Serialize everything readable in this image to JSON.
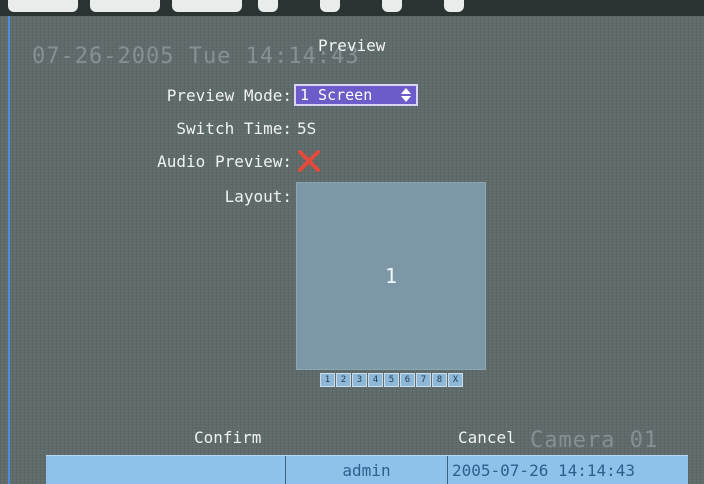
{
  "osd": {
    "datetime": "07-26-2005 Tue 14:14:43",
    "camera": "Camera 01"
  },
  "dialog": {
    "title": "Preview",
    "preview_mode": {
      "label": "Preview Mode:",
      "value": "1 Screen"
    },
    "switch_time": {
      "label": "Switch Time:",
      "value": "5S"
    },
    "audio_preview": {
      "label": "Audio Preview:",
      "enabled": false,
      "icon": "x-mark-icon"
    },
    "layout": {
      "label": "Layout:",
      "cells": [
        "1"
      ],
      "channel_buttons": [
        "1",
        "2",
        "3",
        "4",
        "5",
        "6",
        "7",
        "8",
        "X"
      ]
    },
    "buttons": {
      "confirm": "Confirm",
      "cancel": "Cancel"
    }
  },
  "status_bar": {
    "cells": [
      "",
      "admin",
      "2005-07-26 14:14:43"
    ]
  },
  "colors": {
    "background": "#5f6a6a",
    "selection": "#6c5cc9",
    "status_bar": "#8fc2ea",
    "x_mark": "#e5493a",
    "layout_box": "#7c97a5"
  }
}
